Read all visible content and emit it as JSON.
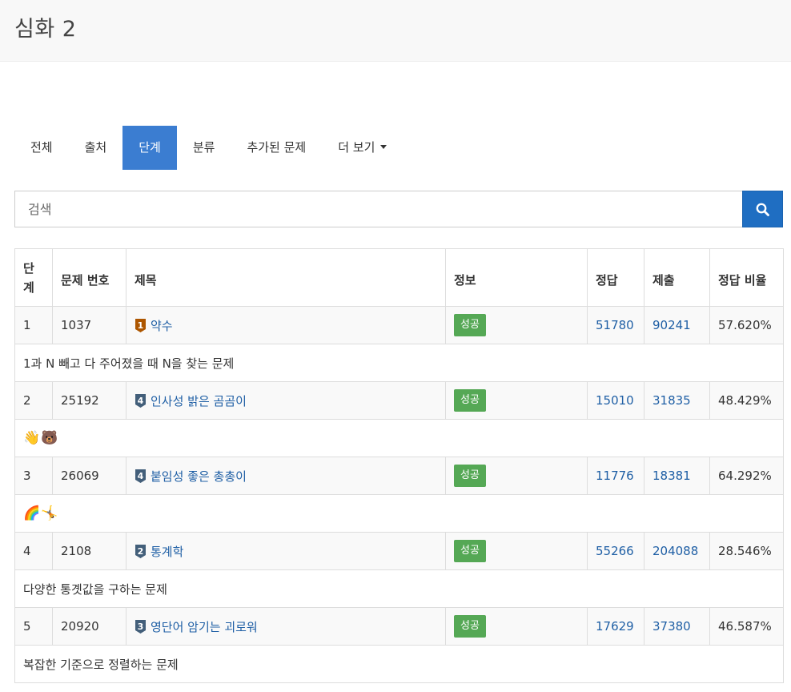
{
  "page": {
    "title": "심화 2"
  },
  "tabs": [
    {
      "label": "전체"
    },
    {
      "label": "출처"
    },
    {
      "label": "단계"
    },
    {
      "label": "분류"
    },
    {
      "label": "추가된 문제"
    },
    {
      "label": "더 보기"
    }
  ],
  "active_tab": "단계",
  "search": {
    "placeholder": "검색",
    "value": "",
    "button_icon": "search-icon"
  },
  "table": {
    "headers": {
      "level": "단계",
      "problem_id": "문제 번호",
      "title": "제목",
      "info": "정보",
      "accepted": "정답",
      "submissions": "제출",
      "ratio": "정답 비율"
    },
    "rows": [
      {
        "level": "1",
        "problem_id": "1037",
        "tier_icon": "bronze-1-tier-icon",
        "tier_color": "#ad5600",
        "tier_digit": "1",
        "title": "약수",
        "info": "성공",
        "accepted": "51780",
        "submissions": "90241",
        "ratio": "57.620%",
        "desc": "1과 N 빼고 다 주어졌을 때 N을 찾는 문제"
      },
      {
        "level": "2",
        "problem_id": "25192",
        "tier_icon": "silver-4-tier-icon",
        "tier_color": "#435f7a",
        "tier_digit": "4",
        "title": "인사성 밝은 곰곰이",
        "info": "성공",
        "accepted": "15010",
        "submissions": "31835",
        "ratio": "48.429%",
        "desc": "👋🐻"
      },
      {
        "level": "3",
        "problem_id": "26069",
        "tier_icon": "silver-4-tier-icon",
        "tier_color": "#435f7a",
        "tier_digit": "4",
        "title": "붙임성 좋은 총총이",
        "info": "성공",
        "accepted": "11776",
        "submissions": "18381",
        "ratio": "64.292%",
        "desc": "🌈🤸"
      },
      {
        "level": "4",
        "problem_id": "2108",
        "tier_icon": "silver-2-tier-icon",
        "tier_color": "#435f7a",
        "tier_digit": "2",
        "title": "통계학",
        "info": "성공",
        "accepted": "55266",
        "submissions": "204088",
        "ratio": "28.546%",
        "desc": "다양한 통곗값을 구하는 문제"
      },
      {
        "level": "5",
        "problem_id": "20920",
        "tier_icon": "silver-3-tier-icon",
        "tier_color": "#435f7a",
        "tier_digit": "3",
        "title": "영단어 암기는 괴로워",
        "info": "성공",
        "accepted": "17629",
        "submissions": "37380",
        "ratio": "46.587%",
        "desc": "복잡한 기준으로 정렬하는 문제"
      }
    ]
  },
  "colors": {
    "accent": "#3b7dd1",
    "search_button": "#1f6ec2",
    "link": "#1f5fa5",
    "success_badge": "#55a855"
  }
}
